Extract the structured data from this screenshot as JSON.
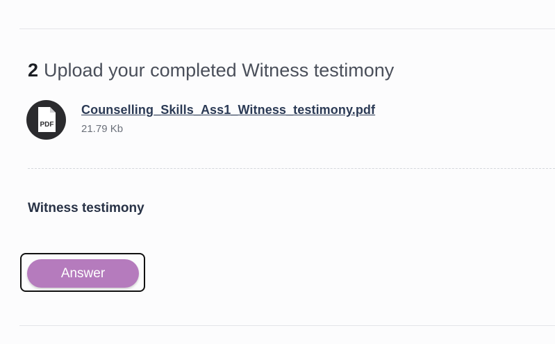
{
  "section": {
    "step_number": "2",
    "heading": "Upload your completed Witness testimony"
  },
  "attachment": {
    "icon": "pdf-file-icon",
    "icon_label": "PDF",
    "filename": "Counselling_Skills_Ass1_Witness_testimony.pdf",
    "size": "21.79 Kb"
  },
  "question": {
    "label": "Witness testimony",
    "answer_button_label": "Answer"
  },
  "colors": {
    "accent": "#b57bbd",
    "icon_bg": "#2b2b2e",
    "link": "#2b3a55"
  }
}
